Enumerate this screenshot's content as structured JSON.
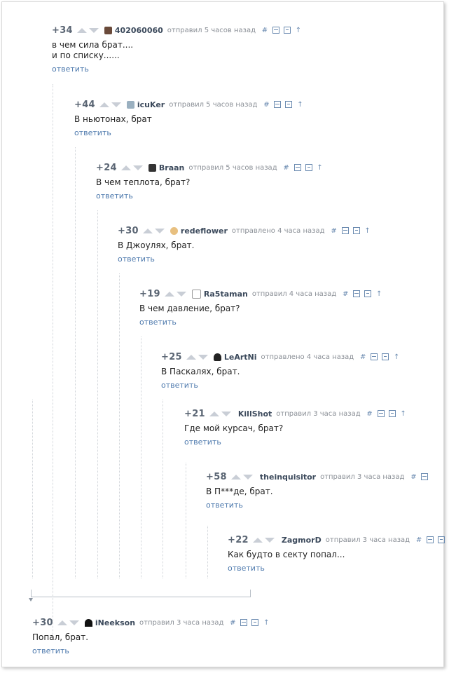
{
  "colors": {
    "link": "#4d79ad",
    "author": "#3c4a5c",
    "rating": "#5b6674",
    "time": "#8a8f96"
  },
  "comments": [
    {
      "rating": "+34",
      "author": "402060060",
      "time": "отправил 5 часов назад",
      "lines": [
        "в чем сила брат....",
        "и по списку......"
      ],
      "reply": "ответить",
      "avatar_color": "#6a4a3a"
    },
    {
      "rating": "+44",
      "author": "icuKer",
      "time": "отправил 5 часов назад",
      "lines": [
        "В ньютонах, брат"
      ],
      "reply": "ответить",
      "avatar_color": "#9ab0c0"
    },
    {
      "rating": "+24",
      "author": "Braan",
      "time": "отправил 5 часов назад",
      "lines": [
        "В чем теплота, брат?"
      ],
      "reply": "ответить",
      "avatar_color": "#333333"
    },
    {
      "rating": "+30",
      "author": "redeflower",
      "time": "отправлено 4 часа назад",
      "lines": [
        "В Джоулях, брат."
      ],
      "reply": "ответить",
      "avatar_color": "#e8c080"
    },
    {
      "rating": "+19",
      "author": "Ra5taman",
      "time": "отправил 4 часа назад",
      "lines": [
        "В чем давление, брат?"
      ],
      "reply": "ответить",
      "avatar_color": "#bbbbbb"
    },
    {
      "rating": "+25",
      "author": "LeArtNi",
      "time": "отправлено 4 часа назад",
      "lines": [
        "В Паскалях, брат."
      ],
      "reply": "ответить",
      "avatar_color": "#222222"
    },
    {
      "rating": "+21",
      "author": "KillShot",
      "time": "отправил 3 часа назад",
      "lines": [
        "Где мой курсач, брат?"
      ],
      "reply": "ответить",
      "avatar_color": ""
    },
    {
      "rating": "+58",
      "author": "theinquisitor",
      "time": "отправил 3 часа назад",
      "lines": [
        "В П***де, брат."
      ],
      "reply": "ответить",
      "avatar_color": ""
    },
    {
      "rating": "+22",
      "author": "ZagmorD",
      "time": "отправил 3 часа назад",
      "lines": [
        "Как будто в секту попал..."
      ],
      "reply": "ответить",
      "avatar_color": ""
    },
    {
      "rating": "+30",
      "author": "iNeekson",
      "time": "отправил 3 часа назад",
      "lines": [
        "Попал, брат."
      ],
      "reply": "ответить",
      "avatar_color": "#111111"
    }
  ],
  "icons": [
    "hash-icon",
    "collapse-icon",
    "save-icon",
    "arrow-up-icon"
  ]
}
